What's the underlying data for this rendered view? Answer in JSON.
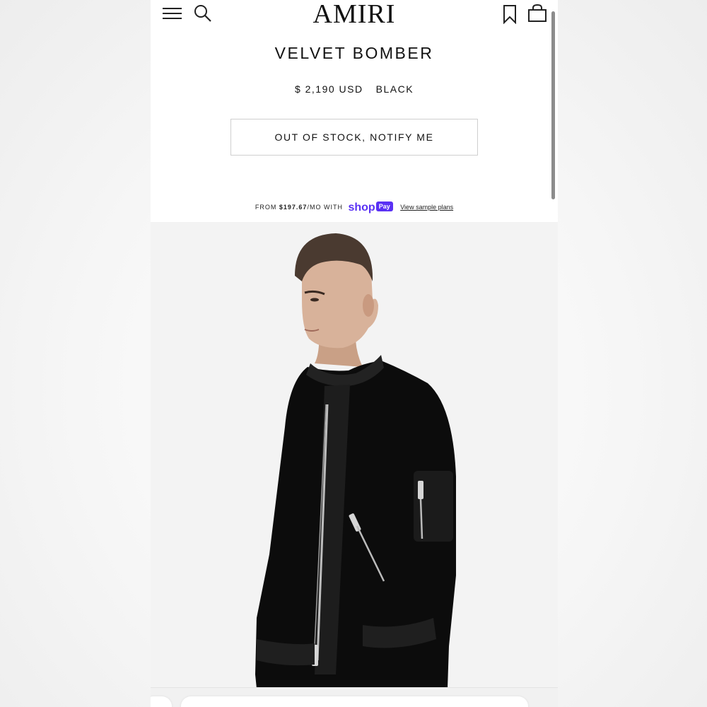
{
  "header": {
    "logo": "AMIRI",
    "icons": [
      "menu-icon",
      "search-icon",
      "bookmark-icon",
      "bag-icon"
    ]
  },
  "product": {
    "title": "VELVET BOMBER",
    "price": "$ 2,190 USD",
    "color": "BLACK",
    "notify_label": "OUT OF STOCK, NOTIFY ME"
  },
  "shop_pay": {
    "prefix": "FROM",
    "amount": "$197.67",
    "suffix": "/MO WITH",
    "brand": "shop",
    "badge": "Pay",
    "link": "View sample plans"
  },
  "colors": {
    "shop_pay_accent": "#5a31f4",
    "text": "#111111",
    "image_background": "#f3f3f3"
  }
}
